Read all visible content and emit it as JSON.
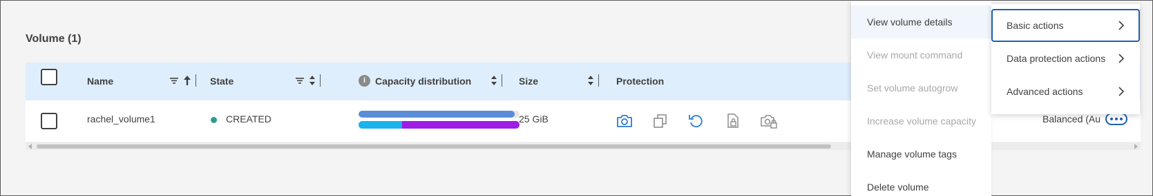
{
  "section": {
    "title": "Volume (1)"
  },
  "table": {
    "headers": {
      "name": "Name",
      "state": "State",
      "capacity": "Capacity distribution",
      "size": "Size",
      "protection": "Protection"
    },
    "rows": [
      {
        "name": "rachel_volume1",
        "state": "CREATED",
        "size": "25 GiB",
        "capacity_used_fraction": 0.97,
        "capacity_seg1_fraction": 0.27,
        "capacity_seg2_fraction": 0.73,
        "tiering": "Balanced (Au"
      }
    ]
  },
  "icons": {
    "info": "info-icon",
    "filter": "filter-icon",
    "sort": "sort-icon",
    "snapshot": "camera-icon",
    "clone": "copy-icon",
    "restore": "restore-icon",
    "lock_doc": "locked-document-icon",
    "lock_camera": "locked-camera-icon",
    "more": "more-icon"
  },
  "colors": {
    "header_bg": "#dfeefc",
    "accent": "#1f5fb0",
    "created_dot": "#2e9c8a",
    "bar_used": "#5b8dd6",
    "bar_seg1": "#1ab3ec",
    "bar_seg2": "#9e1ce6"
  },
  "menu": {
    "items": [
      "View volume details",
      "View mount command",
      "Set volume autogrow",
      "Increase volume capacity",
      "Manage volume tags",
      "Delete volume"
    ]
  },
  "submenu": {
    "items": [
      "Basic actions",
      "Data protection actions",
      "Advanced actions"
    ]
  }
}
